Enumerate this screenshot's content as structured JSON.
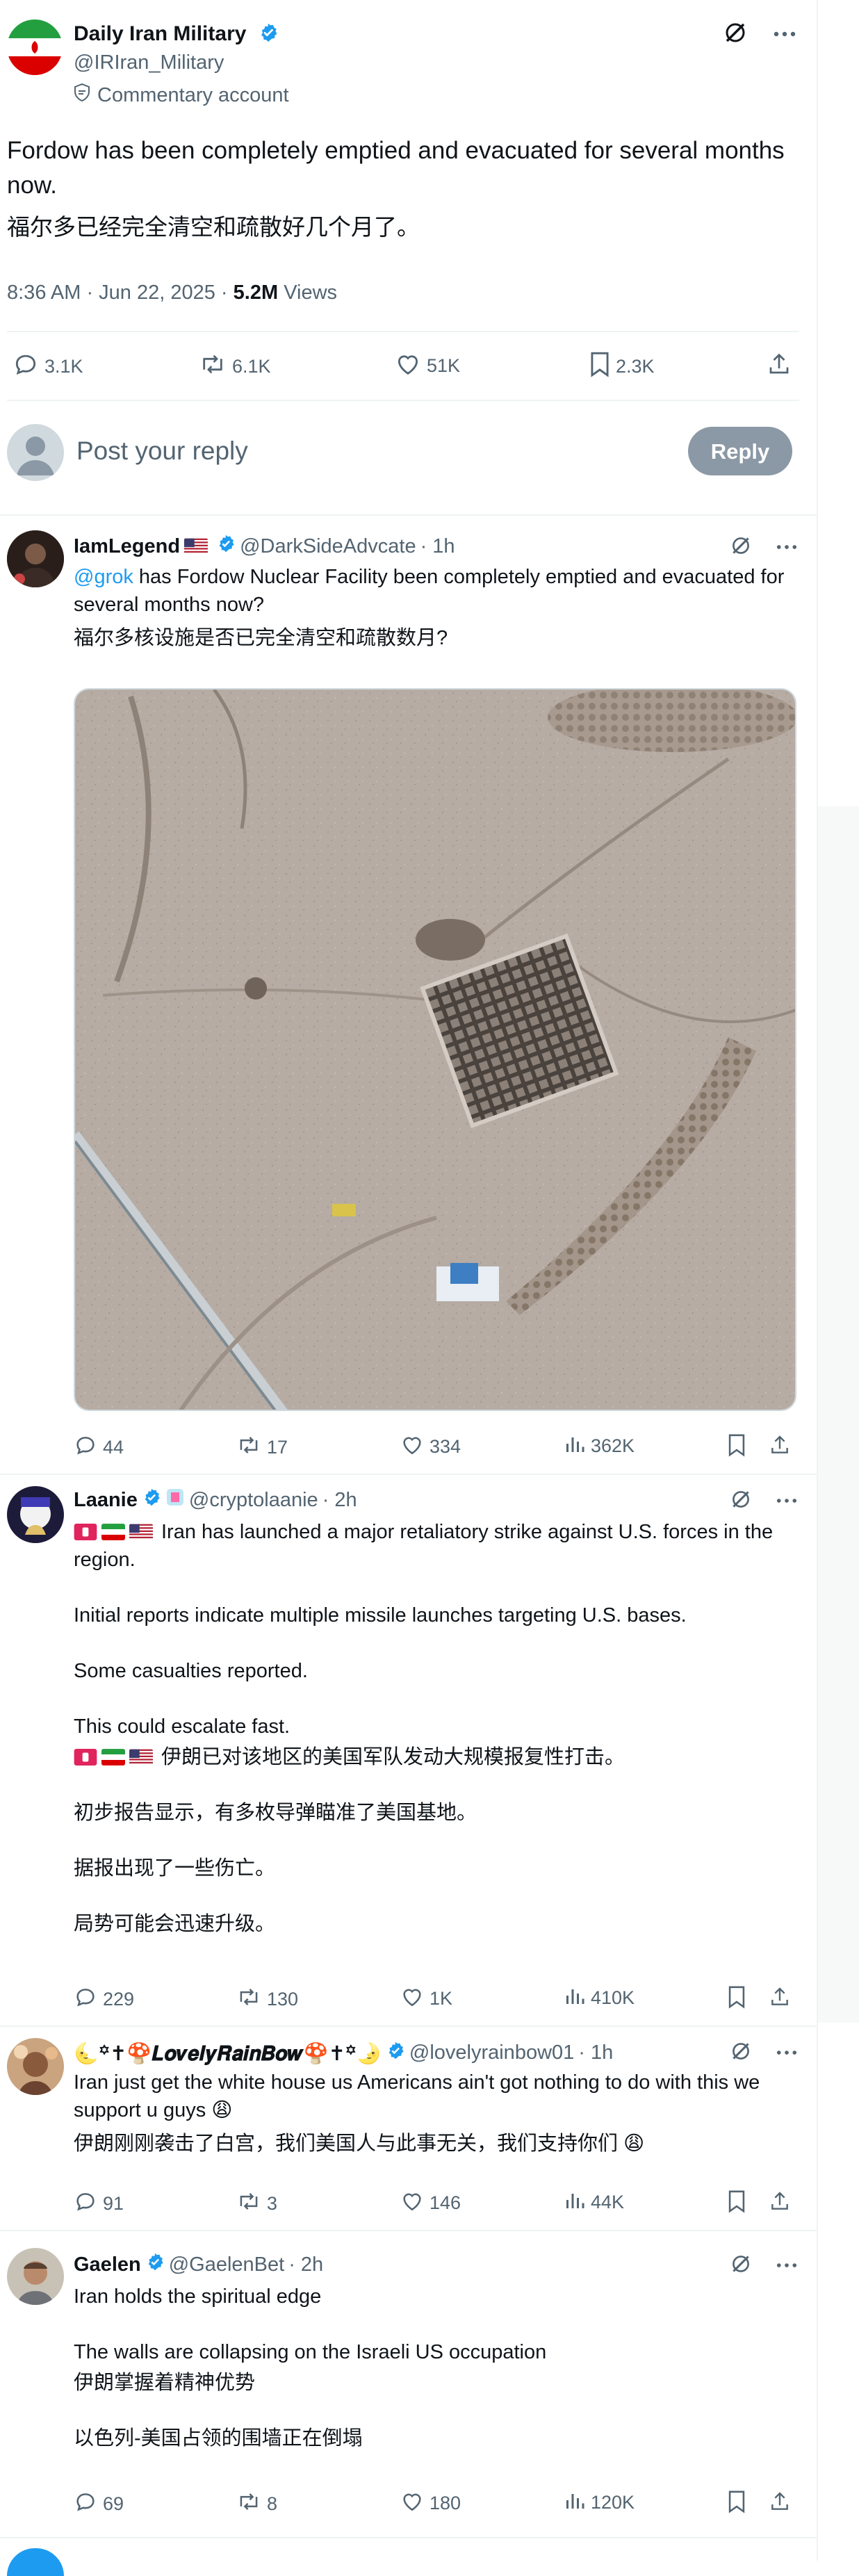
{
  "main": {
    "name": "Daily Iran Military",
    "handle": "@IRIran_Military",
    "label": "Commentary account",
    "text_en": "Fordow has been completely emptied and evacuated for several months now.",
    "text_zh": "福尔多已经完全清空和疏散好几个月了。",
    "time": "8:36 AM · Jun 22, 2025 · ",
    "views_count": "5.2M",
    "views_word": " Views",
    "stats": {
      "replies": "3.1K",
      "reposts": "6.1K",
      "likes": "51K",
      "bookmarks": "2.3K"
    }
  },
  "compose": {
    "placeholder": "Post your reply",
    "button": "Reply"
  },
  "replies": [
    {
      "name": "IamLegend",
      "handle": "@DarkSideAdvcate",
      "time": "· 1h",
      "mention": "@grok",
      "text_en": " has Fordow Nuclear Facility been completely emptied and evacuated for several months now?",
      "text_zh": "福尔多核设施是否已完全清空和疏散数月?",
      "stats": {
        "replies": "44",
        "reposts": "17",
        "likes": "334",
        "views": "362K"
      }
    },
    {
      "name": "Laanie",
      "handle": "@cryptolaanie",
      "time": "· 2h",
      "line1": "Iran has launched a major retaliatory strike against U.S. forces in the region.",
      "line2": "Initial reports indicate multiple missile launches targeting U.S. bases.",
      "line3": "Some casualties reported.",
      "line4": "This could escalate fast.",
      "zh1": "伊朗已对该地区的美国军队发动大规模报复性打击。",
      "zh2": "初步报告显示，有多枚导弹瞄准了美国基地。",
      "zh3": "据报出现了一些伤亡。",
      "zh4": "局势可能会迅速升级。",
      "stats": {
        "replies": "229",
        "reposts": "130",
        "likes": "1K",
        "views": "410K"
      }
    },
    {
      "name": "🌜꙳✝︎🍄𝑳𝒐𝒗𝒆𝒍𝒚𝑹𝒂𝒊𝒏𝑩𝒐𝒘🍄✝︎꙳🌛",
      "handle": "@lovelyrainbow01",
      "time": "· 1h",
      "text_en": "Iran just get the white house us Americans ain't got nothing to do with this we support u guys 😩",
      "text_zh": "伊朗刚刚袭击了白宫，我们美国人与此事无关，我们支持你们 😩",
      "stats": {
        "replies": "91",
        "reposts": "3",
        "likes": "146",
        "views": "44K"
      }
    },
    {
      "name": "Gaelen",
      "handle": "@GaelenBet",
      "time": "· 2h",
      "line1": "Iran holds the spiritual edge",
      "line2": "The walls are collapsing on the Israeli US occupation",
      "zh1": "伊朗掌握着精神优势",
      "zh2": "以色列-美国占领的围墙正在倒塌",
      "stats": {
        "replies": "69",
        "reposts": "8",
        "likes": "180",
        "views": "120K"
      }
    }
  ],
  "colors": {
    "accent": "#1d9bf0",
    "muted": "#536471",
    "verified": "#1d9bf0"
  }
}
